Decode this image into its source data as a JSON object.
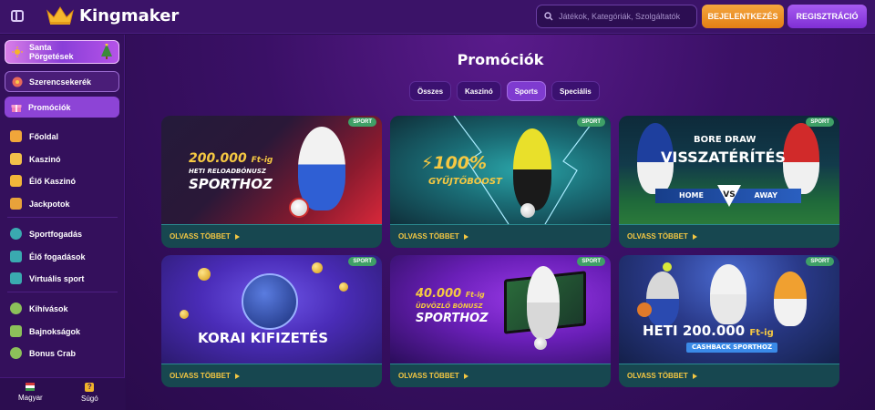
{
  "header": {
    "brand": "Kingmaker",
    "search_placeholder": "Játékok, Kategóriák, Szolgáltatók",
    "login_label": "BEJELENTKEZÉS",
    "register_label": "REGISZTRÁCIÓ"
  },
  "sidebar": {
    "santa_line1": "Santa",
    "santa_line2": "Pörgetések",
    "wheel": "Szerencsekerék",
    "promo": "Promóciók",
    "items": [
      "Főoldal",
      "Kaszinó",
      "Élő Kaszinó",
      "Jackpotok",
      "Sportfogadás",
      "Élő fogadások",
      "Virtuális sport",
      "Kihívások",
      "Bajnokságok",
      "Bonus Crab"
    ],
    "footer": {
      "language": "Magyar",
      "help": "Súgó",
      "help_icon": "?"
    }
  },
  "main": {
    "title": "Promóciók",
    "tabs": [
      "Összes",
      "Kaszinó",
      "Sports",
      "Speciális"
    ],
    "active_tab": "Sports",
    "cards": [
      {
        "badge": "SPORT",
        "line1": "200.000",
        "line1b": "Ft-ig",
        "line2": "HETI RELOADBÓNUSZ",
        "line3": "SPORTHOZ",
        "cta": "OLVASS TÖBBET"
      },
      {
        "badge": "SPORT",
        "line1": "100%",
        "line2": "GYŰJTŐBOOST",
        "cta": "OLVASS TÖBBET"
      },
      {
        "badge": "SPORT",
        "line1": "BORE DRAW",
        "line2": "VISSZATÉRÍTÉS",
        "home": "HOME",
        "vs": "VS",
        "away": "AWAY",
        "cta": "OLVASS TÖBBET"
      },
      {
        "badge": "SPORT",
        "line1": "KORAI KIFIZETÉS",
        "cta": "OLVASS TÖBBET"
      },
      {
        "badge": "SPORT",
        "line1": "40.000",
        "line1b": "Ft-ig",
        "line2": "ÜDVÖZLŐ BÓNUSZ",
        "line3": "SPORTHOZ",
        "cta": "OLVASS TÖBBET"
      },
      {
        "badge": "SPORT",
        "line1": "HETI 200.000",
        "line1b": "Ft-ig",
        "line2": "CASHBACK SPORTHOZ",
        "cta": "OLVASS TÖBBET"
      }
    ]
  },
  "colors": {
    "accent_orange": "#e8901f",
    "accent_purple": "#8d44d6",
    "badge_green": "#3fa067",
    "cta_yellow": "#f5c842"
  }
}
